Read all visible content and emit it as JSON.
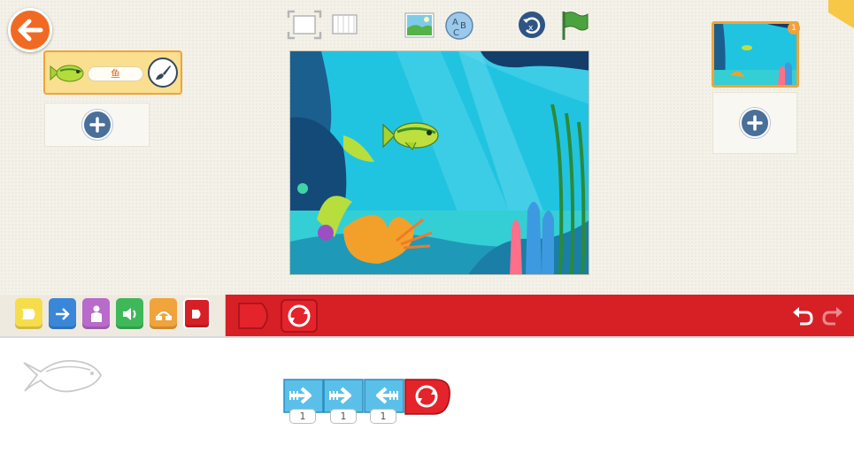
{
  "navigation": {
    "back_icon": "arrow-left-icon"
  },
  "sprite_list": {
    "sprites": [
      {
        "name": "鱼",
        "icon": "fish-icon",
        "edit_icon": "paintbrush-icon"
      }
    ],
    "add_icon": "plus-icon"
  },
  "toolbar": {
    "icons": [
      "fullscreen-icon",
      "grid-icon",
      "background-icon",
      "text-icon",
      "reset-icon",
      "green-flag-icon"
    ]
  },
  "pages": {
    "items": [
      {
        "number": "1"
      }
    ],
    "add_icon": "plus-icon"
  },
  "palette": {
    "categories": [
      {
        "name": "triggering",
        "color": "#f6dd4c"
      },
      {
        "name": "motion",
        "color": "#3a86d9"
      },
      {
        "name": "looks",
        "color": "#b86bcb"
      },
      {
        "name": "sound",
        "color": "#3fb85a"
      },
      {
        "name": "control",
        "color": "#f1a33c"
      },
      {
        "name": "end",
        "color": "#d71f26"
      }
    ],
    "blocks": [
      "end-block",
      "repeat-forever-block"
    ]
  },
  "undo": {
    "undo_icon": "undo-icon",
    "redo_icon": "redo-icon"
  },
  "script": {
    "blocks": [
      {
        "type": "move-right",
        "value": "1"
      },
      {
        "type": "move-right",
        "value": "1"
      },
      {
        "type": "move-left",
        "value": "1"
      },
      {
        "type": "repeat-forever"
      }
    ]
  },
  "colors": {
    "accent_red": "#d71f26",
    "motion_blue": "#5ac0ea",
    "back_orange": "#f06a23"
  }
}
